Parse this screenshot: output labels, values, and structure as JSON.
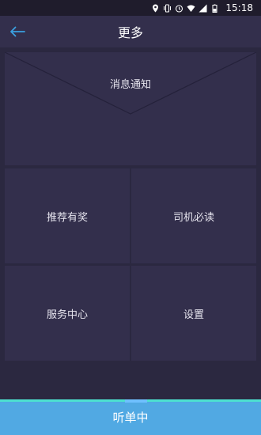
{
  "status_bar": {
    "time": "15:18",
    "icons": [
      "location-icon",
      "vibrate-icon",
      "alarm-icon",
      "wifi-icon",
      "signal-icon",
      "battery-icon"
    ]
  },
  "header": {
    "title": "更多",
    "back_icon": "arrow-left-icon"
  },
  "menu": {
    "notify": "消息通知",
    "items": [
      "推荐有奖",
      "司机必读",
      "服务中心",
      "设置"
    ]
  },
  "bottom_button": "听单中",
  "colors": {
    "background": "#2b2840",
    "panel": "#332f4c",
    "accent": "#51a9e3",
    "stripe": "#4de1d0",
    "back_arrow": "#3aa0e0"
  }
}
